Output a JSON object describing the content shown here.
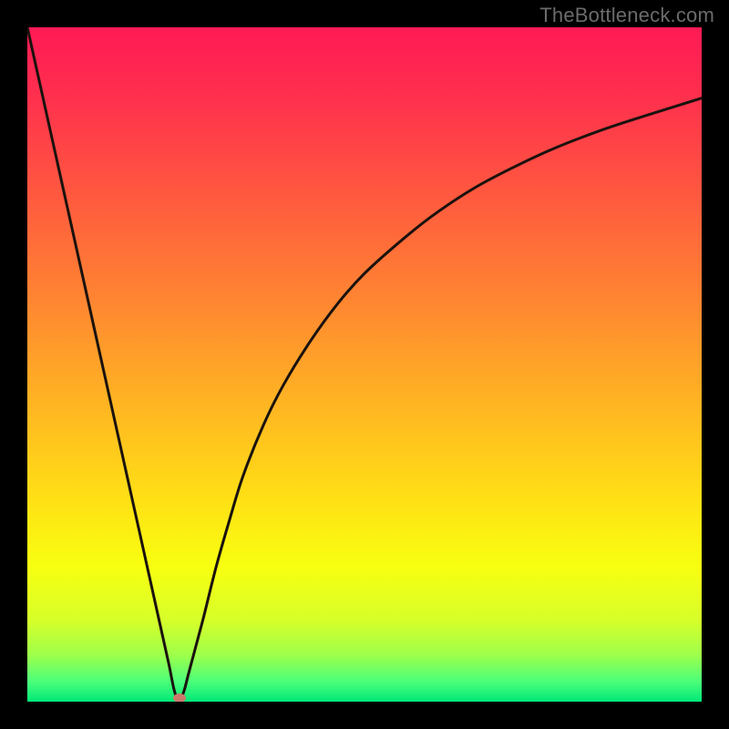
{
  "watermark": "TheBottleneck.com",
  "chart_data": {
    "type": "line",
    "title": "",
    "xlabel": "",
    "ylabel": "",
    "xlim": [
      0,
      100
    ],
    "ylim": [
      0,
      100
    ],
    "grid": false,
    "series": [
      {
        "name": "bottleneck-curve",
        "x": [
          0,
          2,
          4,
          6,
          8,
          10,
          12,
          14,
          16,
          18,
          20,
          21,
          22,
          23,
          24,
          26,
          28,
          30,
          32,
          35,
          38,
          42,
          46,
          50,
          55,
          60,
          66,
          72,
          78,
          85,
          92,
          100
        ],
        "values": [
          100,
          91,
          82,
          73,
          64,
          55,
          46,
          37,
          28,
          19,
          10,
          5.5,
          1,
          1,
          4.5,
          12,
          20,
          27,
          33.5,
          41,
          47,
          53.5,
          59,
          63.5,
          68,
          72,
          76,
          79.2,
          82,
          84.7,
          87,
          89.5
        ]
      }
    ],
    "marker": {
      "x": 22.5,
      "y": 0.5,
      "color": "#c97a6a"
    },
    "gradient_stops": [
      {
        "pos": 0.0,
        "color": "#ff1a55"
      },
      {
        "pos": 0.1,
        "color": "#ff2f4e"
      },
      {
        "pos": 0.25,
        "color": "#ff593f"
      },
      {
        "pos": 0.4,
        "color": "#ff8432"
      },
      {
        "pos": 0.55,
        "color": "#ffb223"
      },
      {
        "pos": 0.7,
        "color": "#ffe015"
      },
      {
        "pos": 0.8,
        "color": "#f8ff10"
      },
      {
        "pos": 0.88,
        "color": "#d6ff2a"
      },
      {
        "pos": 0.93,
        "color": "#9fff4a"
      },
      {
        "pos": 0.97,
        "color": "#4cff7a"
      },
      {
        "pos": 1.0,
        "color": "#00e878"
      }
    ],
    "curve_stroke": "#1a120e",
    "curve_width": 3
  }
}
